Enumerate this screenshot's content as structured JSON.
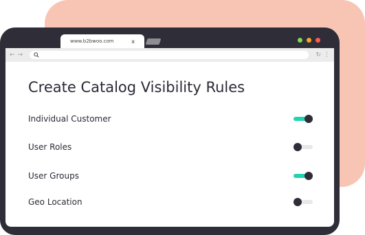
{
  "browser": {
    "tab_title": "www.b2bwoo.com",
    "tab_close": "x",
    "window_dots": [
      "#7ed957",
      "#f6a623",
      "#ff5b52"
    ],
    "icons": {
      "back": "arrow-left-icon",
      "forward": "arrow-right-icon",
      "search": "search-icon",
      "reload": "reload-icon",
      "menu": "more-vert-icon"
    }
  },
  "page": {
    "title": "Create Catalog Visibility Rules",
    "rules": [
      {
        "label": "Individual Customer",
        "enabled": true
      },
      {
        "label": "User Roles",
        "enabled": false
      },
      {
        "label": "User Groups",
        "enabled": true
      },
      {
        "label": "Geo Location",
        "enabled": false
      }
    ]
  },
  "colors": {
    "frame": "#2f2e38",
    "backdrop": "#f8c5b5",
    "toggle_on": "#22d3b2",
    "toggle_off": "#e8e8ec",
    "text": "#2a2a36"
  }
}
